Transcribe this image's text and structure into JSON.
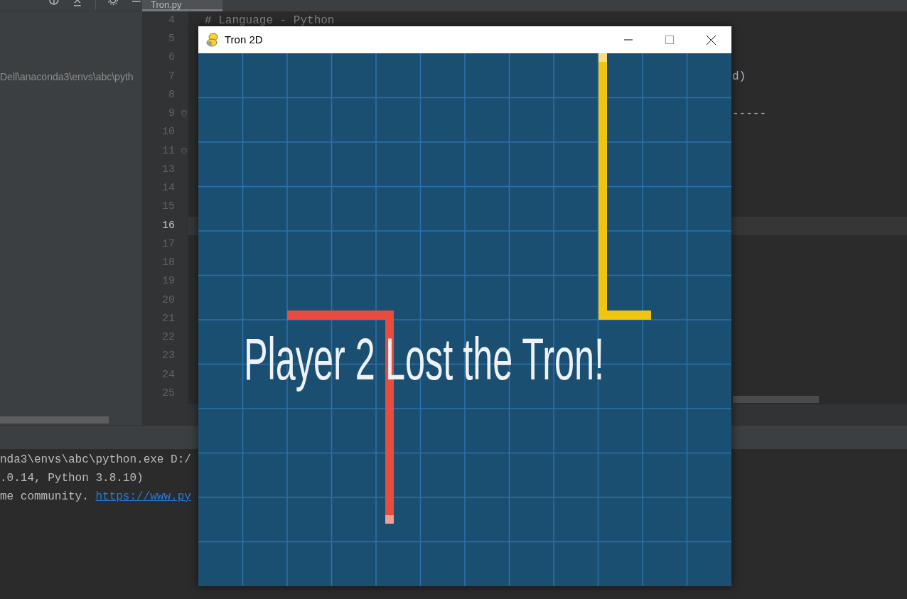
{
  "ide": {
    "tab": {
      "label": "Tron.py",
      "selected": true
    },
    "project_path": "Dell\\anaconda3\\envs\\abc\\pyth",
    "lines": [
      {
        "number": "4",
        "code": "# Language - Python",
        "current": false,
        "fold": false
      },
      {
        "number": "5",
        "current": false,
        "fold": false
      },
      {
        "number": "6",
        "current": false,
        "fold": false
      },
      {
        "number": "7",
        "tail": "d)",
        "current": false,
        "fold": false
      },
      {
        "number": "8",
        "current": false,
        "fold": false
      },
      {
        "number": "9",
        "tail": "-----",
        "current": false,
        "fold": true
      },
      {
        "number": "10",
        "current": false,
        "fold": false
      },
      {
        "number": "11",
        "current": false,
        "fold": true
      },
      {
        "number": "13",
        "current": false,
        "fold": false
      },
      {
        "number": "14",
        "current": false,
        "fold": false
      },
      {
        "number": "15",
        "current": false,
        "fold": false
      },
      {
        "number": "16",
        "current": true,
        "fold": false
      },
      {
        "number": "17",
        "current": false,
        "fold": false
      },
      {
        "number": "18",
        "current": false,
        "fold": false
      },
      {
        "number": "19",
        "current": false,
        "fold": false
      },
      {
        "number": "20",
        "current": false,
        "fold": false
      },
      {
        "number": "21",
        "current": false,
        "fold": false
      },
      {
        "number": "22",
        "current": false,
        "fold": false
      },
      {
        "number": "23",
        "current": false,
        "fold": false
      },
      {
        "number": "24",
        "current": false,
        "fold": false
      },
      {
        "number": "25",
        "current": false,
        "fold": false
      }
    ],
    "console": [
      {
        "text": "nda3\\envs\\abc\\python.exe D:/"
      },
      {
        "text": ".0.14, Python 3.8.10)"
      },
      {
        "text": "me community. ",
        "link": "https://www.py"
      }
    ]
  },
  "game_window": {
    "title": "Tron 2D",
    "players": [
      {
        "color": "#f1c40f"
      },
      {
        "color": "#e74c3c"
      }
    ],
    "message": "Player 2 Lost the Tron!"
  }
}
